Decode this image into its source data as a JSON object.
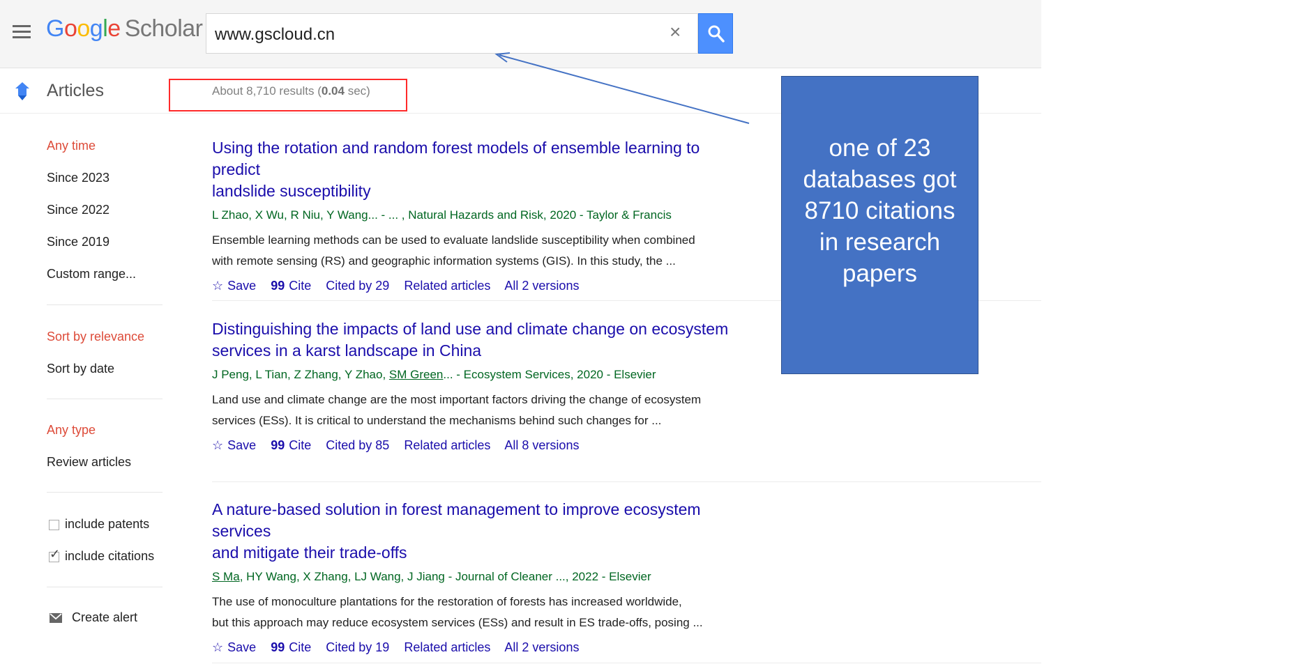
{
  "header": {
    "logo_letters": [
      "G",
      "o",
      "o",
      "g",
      "l",
      "e"
    ],
    "logo_product": "Scholar",
    "search_value": "www.gscloud.cn",
    "clear_symbol": "×",
    "icons": {
      "menu": "hamburger-menu-icon",
      "clear": "close-icon",
      "search": "search-icon"
    }
  },
  "subheader": {
    "articles_label": "Articles",
    "results_prefix": "About 8,710 results (",
    "results_time": "0.04",
    "results_suffix": " sec)"
  },
  "sidebar": {
    "time_filters": [
      "Any time",
      "Since 2023",
      "Since 2022",
      "Since 2019",
      "Custom range..."
    ],
    "sort_options": [
      "Sort by relevance",
      "Sort by date"
    ],
    "type_filters": [
      "Any type",
      "Review articles"
    ],
    "include_patents": {
      "label": "include patents",
      "checked": false
    },
    "include_citations": {
      "label": "include citations",
      "checked": true
    },
    "create_alert": "Create alert"
  },
  "results": [
    {
      "title_line1": "Using the rotation and random forest models of ensemble learning to predict",
      "title_line2": "landslide susceptibility",
      "authors": "L Zhao, X Wu, R Niu, Y Wang... - ... , Natural Hazards and Risk, 2020 - Taylor & Francis",
      "snippet_line1": "Ensemble learning methods can be used to evaluate landslide susceptibility when combined",
      "snippet_line2": "with remote sensing (RS) and geographic information systems (GIS). In this study, the ...",
      "save": "Save",
      "cite": "Cite",
      "cited_by": "Cited by 29",
      "related": "Related articles",
      "versions": "All 2 versions"
    },
    {
      "title_line1": "Distinguishing the impacts of land use and climate change on ecosystem",
      "title_line2": "services in a karst landscape in China",
      "authors_pre": "J Peng, L Tian, Z Zhang, Y Zhao, ",
      "authors_link": "SM Green",
      "authors_post": "... - Ecosystem Services, 2020 - Elsevier",
      "snippet_line1": "Land use and climate change are the most important factors driving the change of ecosystem",
      "snippet_line2": "services (ESs). It is critical to understand the mechanisms behind such changes for ...",
      "save": "Save",
      "cite": "Cite",
      "cited_by": "Cited by 85",
      "related": "Related articles",
      "versions": "All 8 versions"
    },
    {
      "title_line1": "A nature-based solution in forest management to improve ecosystem services",
      "title_line2": "and mitigate their trade-offs",
      "authors_link": "S Ma",
      "authors_post": ", HY Wang, X Zhang, LJ Wang, J Jiang - Journal of Cleaner ..., 2022 - Elsevier",
      "snippet_line1": "The use of monoculture plantations for the restoration of forests has increased worldwide,",
      "snippet_line2": "but this approach may reduce ecosystem services (ESs) and result in ES trade-offs, posing ...",
      "save": "Save",
      "cite": "Cite",
      "cited_by": "Cited by 19",
      "related": "Related articles",
      "versions": "All 2 versions"
    }
  ],
  "callout": {
    "lines": [
      "one of 23",
      "databases got",
      "8710 citations",
      "in research",
      "papers"
    ]
  },
  "colors": {
    "link": "#1a0dab",
    "meta_green": "#006621",
    "red_filter": "#dd4b39",
    "search_button": "#4d90fe",
    "callout_bg": "#4472c4",
    "annotation_red": "#ff2a2a"
  }
}
